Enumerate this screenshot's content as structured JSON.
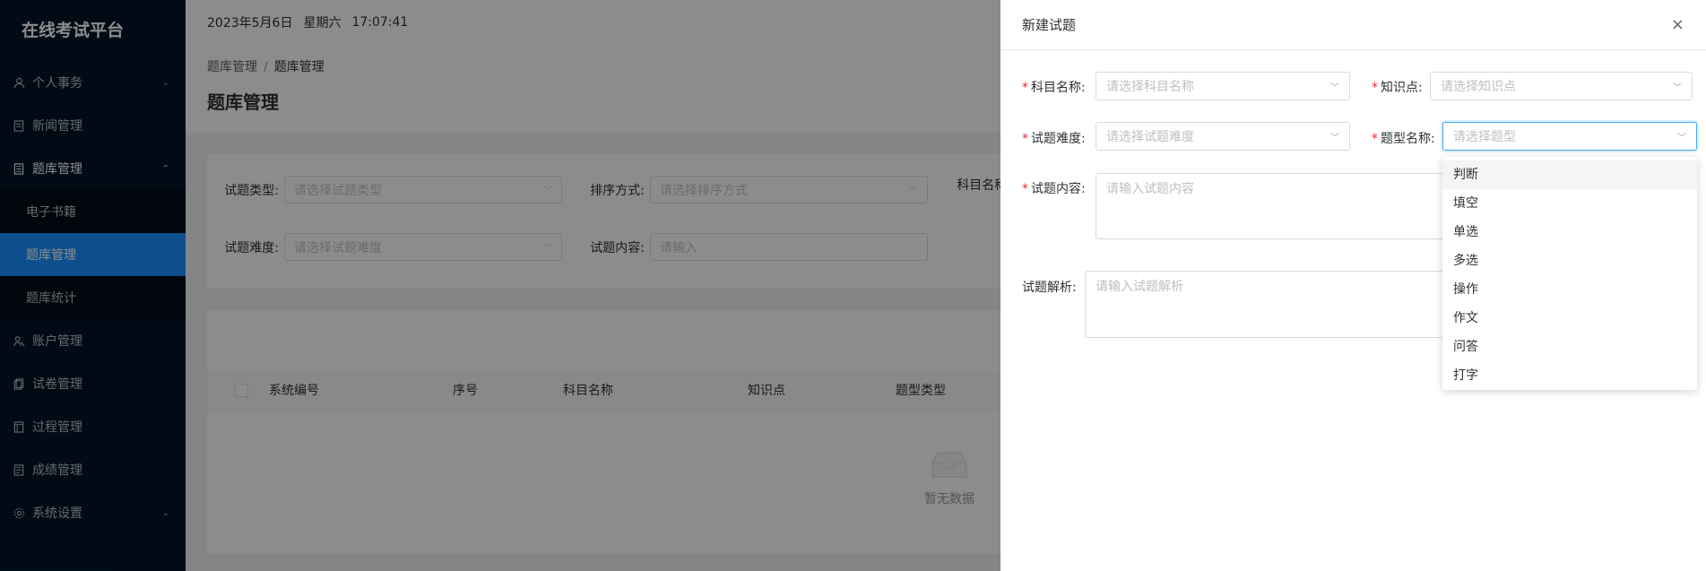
{
  "sidebar": {
    "brand": "在线考试平台",
    "items": [
      {
        "label": "个人事务",
        "chevron": "⌄"
      },
      {
        "label": "新闻管理"
      },
      {
        "label": "题库管理",
        "chevron": "⌃"
      },
      {
        "label": "账户管理"
      },
      {
        "label": "试卷管理"
      },
      {
        "label": "过程管理"
      },
      {
        "label": "成绩管理"
      },
      {
        "label": "系统设置",
        "chevron": "⌄"
      }
    ],
    "submenu": [
      {
        "label": "电子书籍"
      },
      {
        "label": "题库管理"
      },
      {
        "label": "题库统计"
      }
    ]
  },
  "topbar": {
    "date": "2023年5月6日",
    "weekday": "星期六",
    "time": "17:07:41"
  },
  "breadcrumb": {
    "parent": "题库管理",
    "sep": "/",
    "current": "题库管理"
  },
  "page": {
    "title": "题库管理"
  },
  "filters": {
    "type_label": "试题类型:",
    "type_ph": "请选择试题类型",
    "sort_label": "排序方式:",
    "sort_ph": "请选择排序方式",
    "subject_label": "科目名称:",
    "difficulty_label": "试题难度:",
    "difficulty_ph": "请选择试题难度",
    "content_label": "试题内容:",
    "content_ph": "请输入"
  },
  "table": {
    "headers": [
      "系统编号",
      "序号",
      "科目名称",
      "知识点",
      "题型类型"
    ],
    "empty": "暂无数据"
  },
  "drawer": {
    "title": "新建试题",
    "close": "×",
    "subject_label": "科目名称:",
    "subject_ph": "请选择科目名称",
    "knowledge_label": "知识点:",
    "knowledge_ph": "请选择知识点",
    "difficulty_label": "试题难度:",
    "difficulty_ph": "请选择试题难度",
    "qtype_label": "题型名称:",
    "qtype_ph": "请选择题型",
    "content_label": "试题内容:",
    "content_ph": "请输入试题内容",
    "analysis_label": "试题解析:",
    "analysis_ph": "请输入试题解析",
    "req": "*"
  },
  "dropdown": {
    "options": [
      "判断",
      "填空",
      "单选",
      "多选",
      "操作",
      "作文",
      "问答",
      "打字"
    ]
  },
  "colors": {
    "sidebar_bg": "#001529",
    "active": "#1890ff",
    "required": "#f5222d"
  }
}
